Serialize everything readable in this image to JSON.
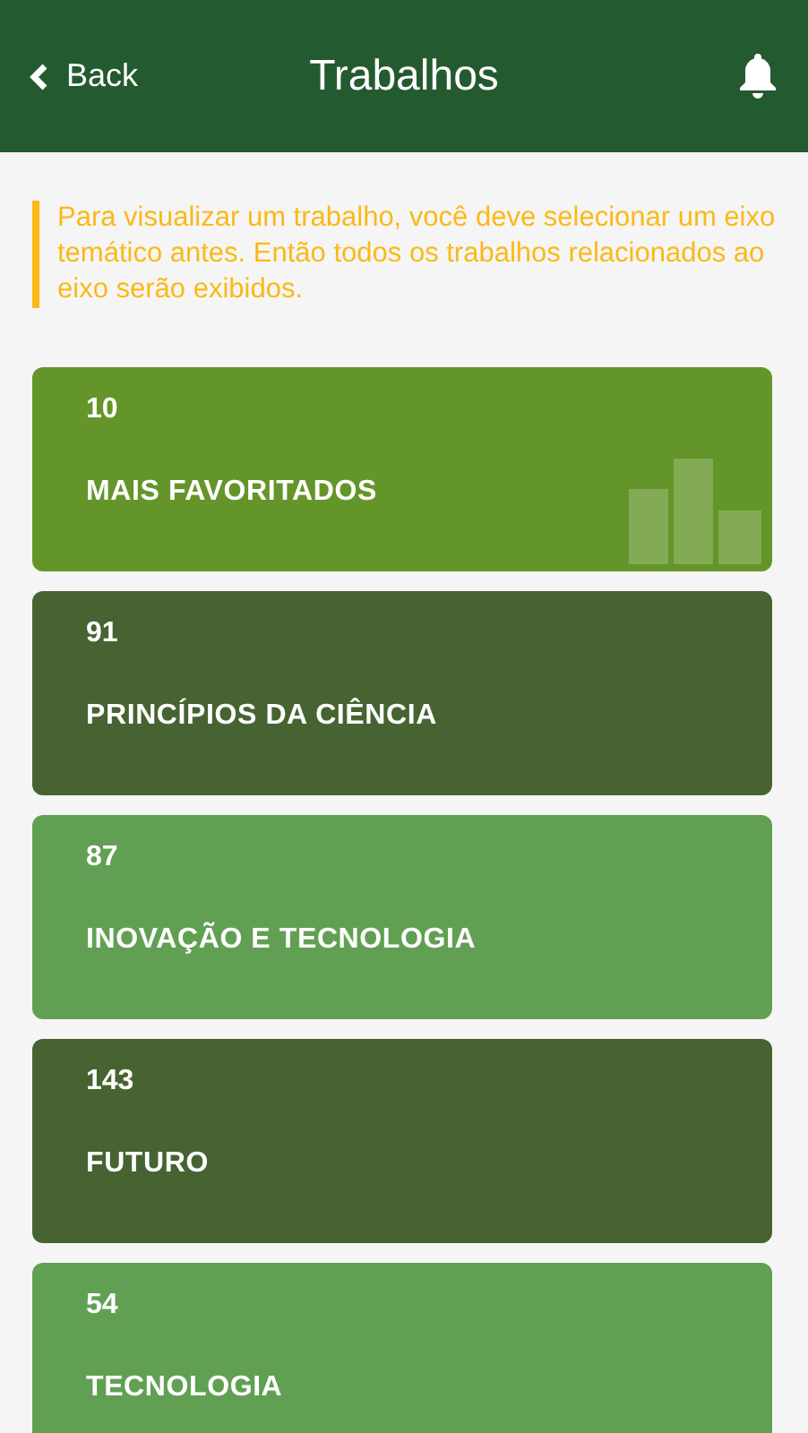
{
  "header": {
    "back": "Back",
    "title": "Trabalhos"
  },
  "notice": "Para visualizar um trabalho, você deve selecionar um eixo temático antes. Então todos os trabalhos relacionados ao eixo serão exibidos.",
  "categories": [
    {
      "count": "10",
      "title": "MAIS FAVORITADOS",
      "color": "#64952a",
      "kind": "featured"
    },
    {
      "count": "91",
      "title": "PRINCÍPIOS DA CIÊNCIA",
      "color": "#466331",
      "kind": "plain"
    },
    {
      "count": "87",
      "title": "INOVAÇÃO E TECNOLOGIA",
      "color": "#61a053",
      "kind": "plain"
    },
    {
      "count": "143",
      "title": "FUTURO",
      "color": "#466331",
      "kind": "plain"
    },
    {
      "count": "54",
      "title": "TECNOLOGIA",
      "color": "#61a053",
      "kind": "plain"
    }
  ]
}
